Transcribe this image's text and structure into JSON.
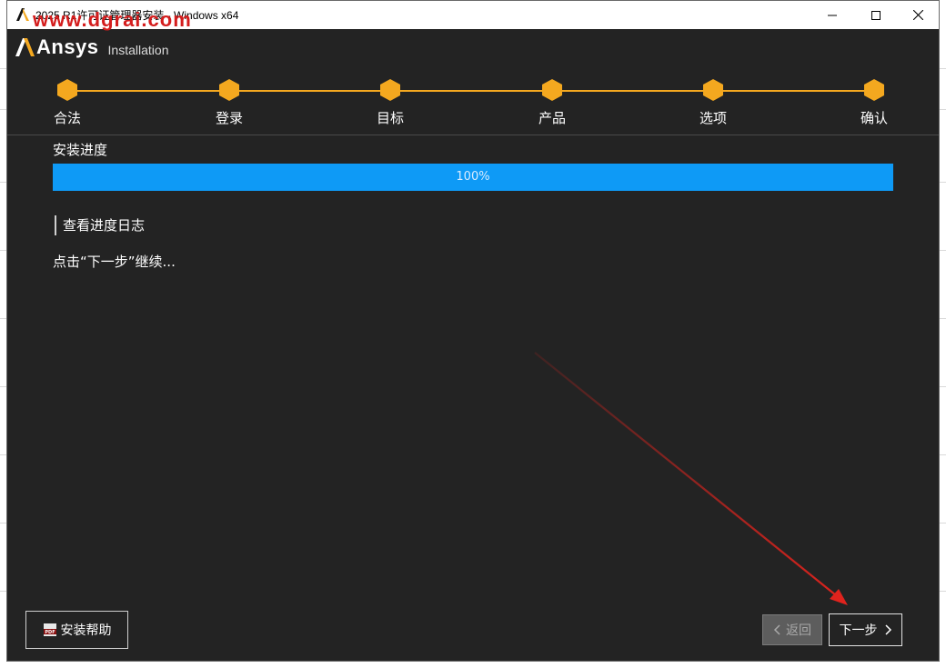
{
  "window": {
    "title": "2025 R1许可证管理器安装 - Windows x64",
    "watermark": "www.dgrai.com"
  },
  "header": {
    "brand": "Ansys",
    "subtitle": "Installation"
  },
  "steps": [
    {
      "label": "合法"
    },
    {
      "label": "登录"
    },
    {
      "label": "目标"
    },
    {
      "label": "产品"
    },
    {
      "label": "选项"
    },
    {
      "label": "确认"
    }
  ],
  "progress": {
    "title": "安装进度",
    "value": 100,
    "label": "100%"
  },
  "log_link": "查看进度日志",
  "hint": "点击“下一步”继续...",
  "footer": {
    "help_label": "安装帮助",
    "back_label": "返回",
    "next_label": "下一步"
  },
  "colors": {
    "accent": "#f4a81f",
    "progress": "#0e9af6",
    "background": "#232323",
    "annotation_arrow": "#e0231d"
  }
}
